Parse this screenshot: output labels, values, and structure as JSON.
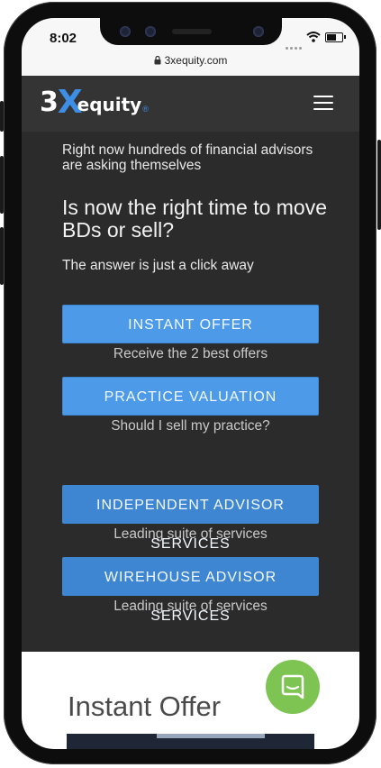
{
  "status_bar": {
    "time": "8:02"
  },
  "browser": {
    "url": "3xequity.com"
  },
  "nav": {
    "logo": {
      "part1": "3",
      "part2": "X",
      "part3": "equity",
      "mark": "®"
    },
    "menu_icon": "hamburger-icon"
  },
  "hero": {
    "intro": "Right now hundreds of financial advisors are asking themselves",
    "headline": "Is now the right time to move BDs or sell?",
    "subline": "The answer is just a click away"
  },
  "actions": [
    {
      "label": "INSTANT OFFER",
      "caption": "Receive the 2 best offers"
    },
    {
      "label": "PRACTICE VALUATION",
      "caption": "Should I sell my practice?"
    },
    {
      "label": "INDEPENDENT ADVISOR SERVICES",
      "caption": "Leading suite of services"
    },
    {
      "label": "WIREHOUSE ADVISOR SERVICES",
      "caption": "Leading suite of services"
    }
  ],
  "section": {
    "title": "Instant Offer"
  },
  "colors": {
    "accent": "#4c9ae8",
    "logo_x": "#3d8fe6",
    "nav_bg": "#343434",
    "content_bg": "#2b2b2b",
    "chat_bubble": "#7dc452"
  }
}
